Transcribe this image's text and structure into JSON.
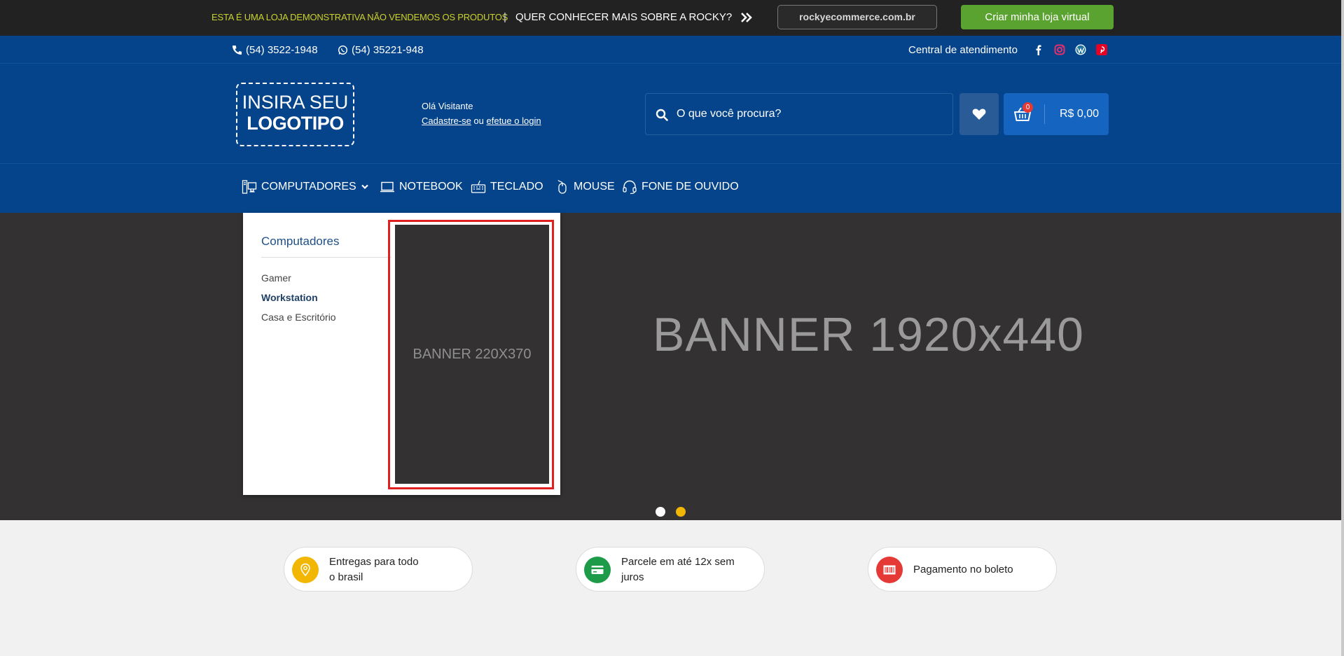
{
  "promo": {
    "notice": "ESTA É UMA LOJA DEMONSTRATIVA NÃO VENDEMOS OS PRODUTOS",
    "separator": "|",
    "question": "QUER CONHECER MAIS SOBRE A ROCKY?",
    "site_button": "rockyecommerce.com.br",
    "create_button": "Criar minha loja virtual"
  },
  "contact": {
    "phone": "(54) 3522-1948",
    "whatsapp": "(54) 35221-948",
    "central": "Central de atendimento",
    "social": [
      "facebook-icon",
      "instagram-icon",
      "wordpress-icon",
      "pinterest-icon"
    ]
  },
  "logo": {
    "line1": "INSIRA SEU",
    "line2": "LOGOTIPO"
  },
  "user": {
    "greeting": "Olá Visitante",
    "register": "Cadastre-se",
    "or": " ou ",
    "login": "efetue o login"
  },
  "search": {
    "placeholder": "O que você procura?"
  },
  "cart": {
    "count": "0",
    "total": "R$ 0,00"
  },
  "nav": [
    {
      "label": "COMPUTADORES",
      "icon": "computer-icon"
    },
    {
      "label": "NOTEBOOK",
      "icon": "notebook-icon"
    },
    {
      "label": "TECLADO",
      "icon": "keyboard-icon"
    },
    {
      "label": "MOUSE",
      "icon": "mouse-icon"
    },
    {
      "label": "FONE DE OUVIDO",
      "icon": "headphones-icon"
    }
  ],
  "hero": {
    "banner_text": "BANNER 1920x440"
  },
  "dropdown": {
    "title": "Computadores",
    "items": [
      {
        "label": "Gamer",
        "active": false
      },
      {
        "label": "Workstation",
        "active": true
      },
      {
        "label": "Casa e Escritório",
        "active": false
      }
    ],
    "banner_text": "BANNER 220X370"
  },
  "features": [
    {
      "line1": "Entregas para todo",
      "line2": "o brasil",
      "icon": "map-pin-icon",
      "color": "#f2b705"
    },
    {
      "line1": "Parcele em até 12x sem",
      "line2": "juros",
      "icon": "credit-card-icon",
      "color": "#1d9b48"
    },
    {
      "line1": "Pagamento no boleto",
      "line2": "",
      "icon": "barcode-icon",
      "color": "#e53935"
    }
  ],
  "colors": {
    "promo_bg": "#222222",
    "header_bg": "#05448a",
    "cart_bg": "#1565c0",
    "create_button": "#5ba330",
    "hero_bg": "#333132",
    "dot_active": "#f2b705"
  }
}
